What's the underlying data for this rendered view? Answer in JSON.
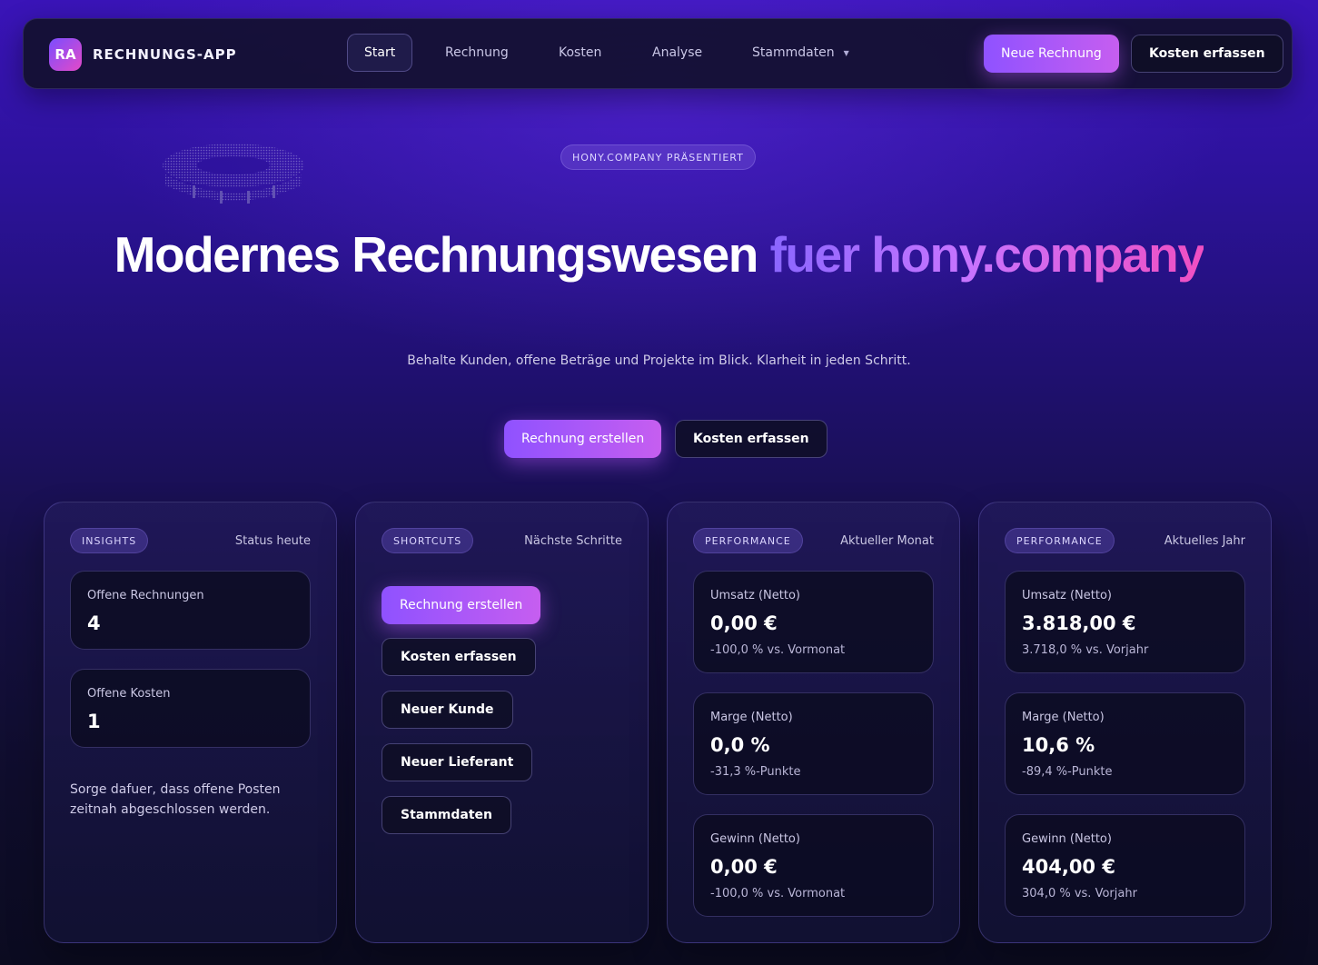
{
  "brand": {
    "logo_text": "RA",
    "name": "RECHNUNGS-APP"
  },
  "nav": {
    "items": [
      {
        "label": "Start"
      },
      {
        "label": "Rechnung"
      },
      {
        "label": "Kosten"
      },
      {
        "label": "Analyse"
      },
      {
        "label": "Stammdaten"
      }
    ],
    "primary_label": "Neue Rechnung",
    "secondary_label": "Kosten erfassen"
  },
  "hero": {
    "badge": "HONY.COMPANY PRÄSENTIERT",
    "title_main": "Modernes Rechnungswesen",
    "title_accent": "fuer hony.company",
    "subtitle": "Behalte Kunden, offene Beträge und Projekte im Blick. Klarheit in jeden Schritt.",
    "primary_label": "Rechnung erstellen",
    "secondary_label": "Kosten erfassen"
  },
  "insights": {
    "chip": "INSIGHTS",
    "meta": "Status heute",
    "stats": [
      {
        "label": "Offene Rechnungen",
        "value": "4"
      },
      {
        "label": "Offene Kosten",
        "value": "1"
      }
    ],
    "note": "Sorge dafuer, dass offene Posten zeitnah abgeschlossen werden."
  },
  "shortcuts": {
    "chip": "SHORTCUTS",
    "meta": "Nächste Schritte",
    "buttons": [
      {
        "label": "Rechnung erstellen"
      },
      {
        "label": "Kosten erfassen"
      },
      {
        "label": "Neuer Kunde"
      },
      {
        "label": "Neuer Lieferant"
      },
      {
        "label": "Stammdaten"
      }
    ]
  },
  "performance_month": {
    "chip": "PERFORMANCE",
    "meta": "Aktueller Monat",
    "stats": [
      {
        "label": "Umsatz (Netto)",
        "value": "0,00 €",
        "sub": "-100,0 % vs. Vormonat"
      },
      {
        "label": "Marge (Netto)",
        "value": "0,0 %",
        "sub": "-31,3 %-Punkte"
      },
      {
        "label": "Gewinn (Netto)",
        "value": "0,00 €",
        "sub": "-100,0 % vs. Vormonat"
      }
    ]
  },
  "performance_year": {
    "chip": "PERFORMANCE",
    "meta": "Aktuelles Jahr",
    "stats": [
      {
        "label": "Umsatz (Netto)",
        "value": "3.818,00 €",
        "sub": "3.718,0 % vs. Vorjahr"
      },
      {
        "label": "Marge (Netto)",
        "value": "10,6 %",
        "sub": "-89,4 %-Punkte"
      },
      {
        "label": "Gewinn (Netto)",
        "value": "404,00 €",
        "sub": "304,0 % vs. Vorjahr"
      }
    ]
  },
  "colors": {
    "accent_gradient_start": "#8f52ff",
    "accent_gradient_end": "#c65ef0",
    "title_gradient_end": "#f04fc2",
    "background_top": "#3a14b8",
    "background_bottom": "#0b0b20"
  }
}
